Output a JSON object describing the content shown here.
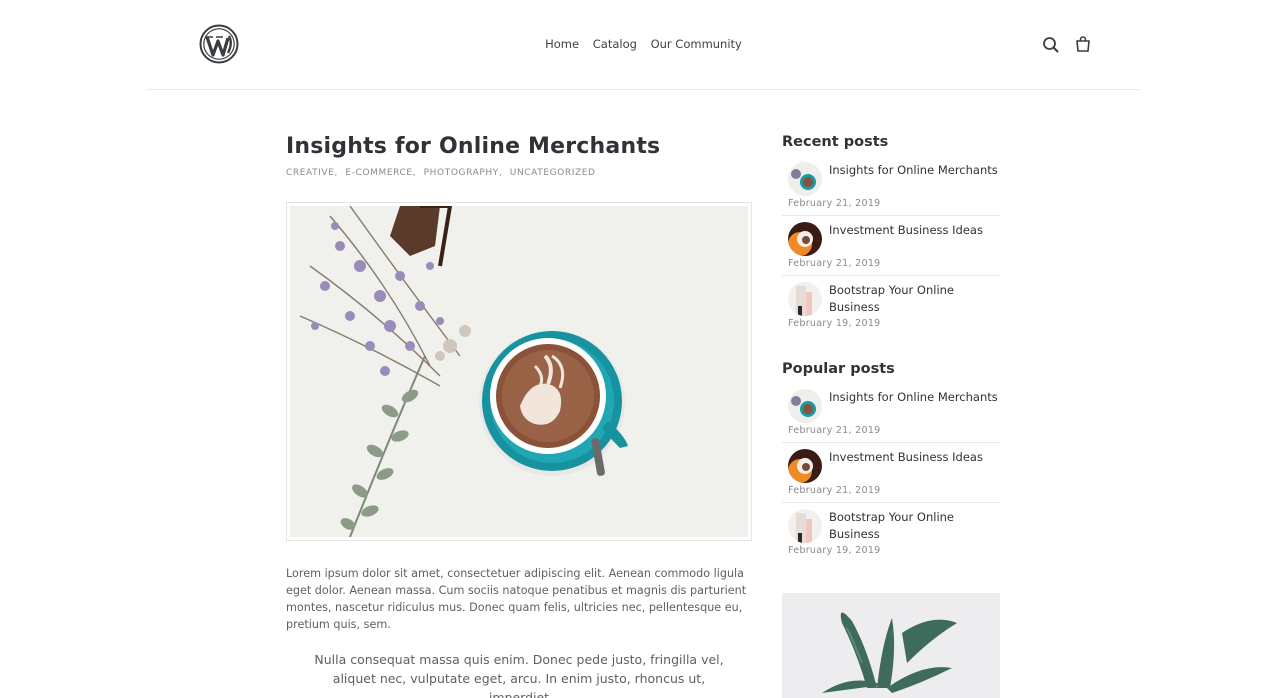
{
  "nav": {
    "items": [
      "Home",
      "Catalog",
      "Our Community"
    ]
  },
  "icons": {
    "logo": "wordpress-logo",
    "search": "search-icon",
    "cart": "cart-icon"
  },
  "article": {
    "title": "Insights for Online Merchants",
    "categories": [
      "CREATIVE,",
      "E-COMMERCE,",
      "PHOTOGRAPHY,",
      "UNCATEGORIZED"
    ],
    "body": "Lorem ipsum dolor sit amet, consectetuer adipiscing elit. Aenean commodo ligula eget dolor. Aenean massa. Cum sociis natoque penatibus et magnis dis parturient montes, nascetur ridiculus mus. Donec quam felis, ultricies nec, pellentesque eu, pretium quis, sem.",
    "quote": "Nulla consequat massa quis enim. Donec pede justo, fringilla vel, aliquet nec, vulputate eget, arcu. In enim justo, rhoncus ut, imperdiet"
  },
  "sidebar": {
    "recent_heading": "Recent posts",
    "recent": [
      {
        "title": "Insights for Online Merchants",
        "date": "February 21, 2019"
      },
      {
        "title": "Investment Business Ideas",
        "date": "February 21, 2019"
      },
      {
        "title": "Bootstrap Your Online Business",
        "date": "February 19, 2019"
      }
    ],
    "popular_heading": "Popular posts",
    "popular": [
      {
        "title": "Insights for Online Merchants",
        "date": "February 21, 2019"
      },
      {
        "title": "Investment Business Ideas",
        "date": "February 21, 2019"
      },
      {
        "title": "Bootstrap Your Online Business",
        "date": "February 19, 2019"
      }
    ]
  },
  "colors": {
    "text": "#2f3337",
    "muted": "#8a8a8a",
    "teal": "#1a9aa6",
    "coffee": "#8a5238"
  }
}
